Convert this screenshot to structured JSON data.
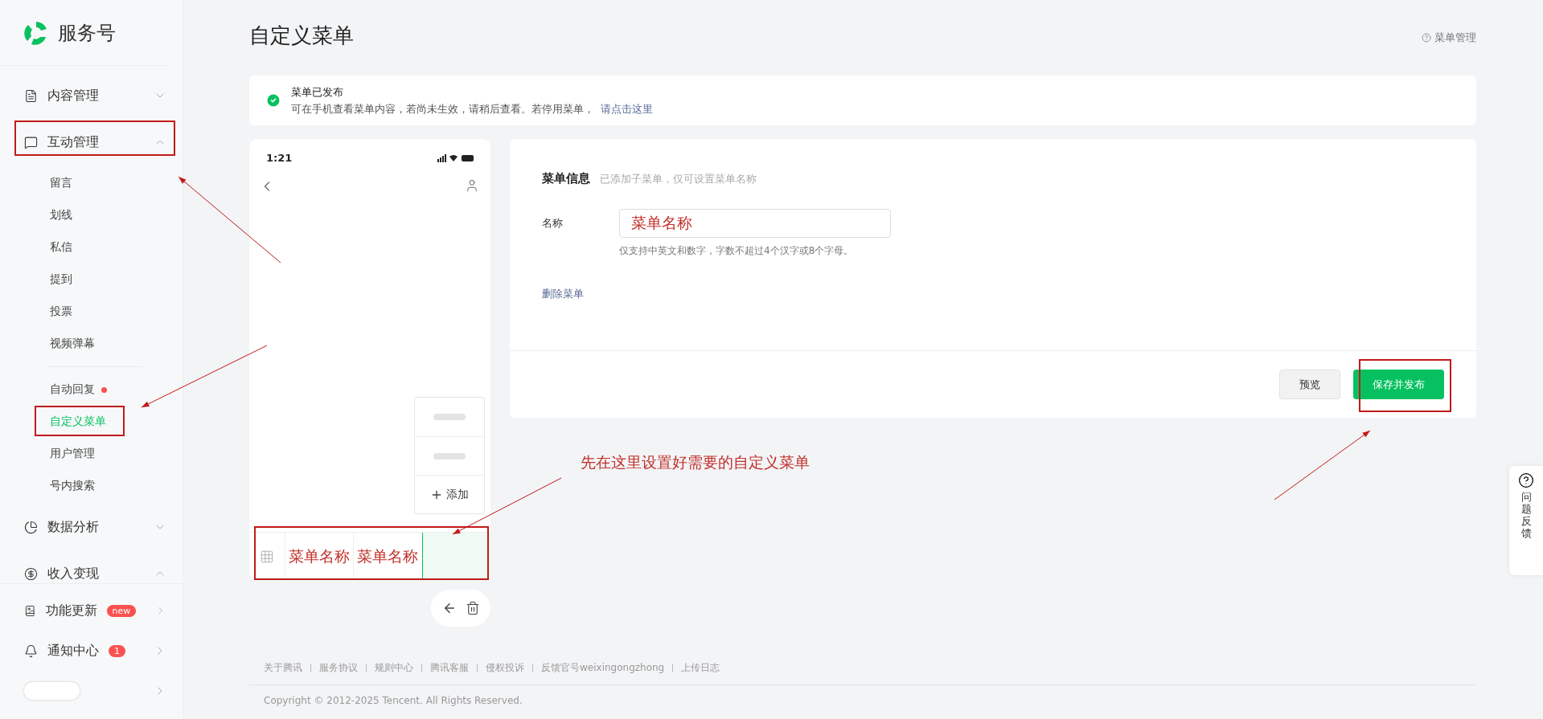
{
  "brand": {
    "name": "服务号"
  },
  "sidebar": {
    "groups": [
      {
        "label": "内容管理",
        "expanded": false,
        "selected": false
      },
      {
        "label": "互动管理",
        "expanded": true,
        "selected": false,
        "sections": [
          {
            "items": [
              {
                "label": "留言",
                "selected": false,
                "dot": false
              },
              {
                "label": "划线",
                "selected": false,
                "dot": false
              },
              {
                "label": "私信",
                "selected": false,
                "dot": false
              },
              {
                "label": "提到",
                "selected": false,
                "dot": false
              },
              {
                "label": "投票",
                "selected": false,
                "dot": false
              },
              {
                "label": "视频弹幕",
                "selected": false,
                "dot": false
              }
            ]
          },
          {
            "items": [
              {
                "label": "自动回复",
                "selected": false,
                "dot": true
              },
              {
                "label": "自定义菜单",
                "selected": true,
                "dot": false
              },
              {
                "label": "用户管理",
                "selected": false,
                "dot": false
              },
              {
                "label": "号内搜索",
                "selected": false,
                "dot": false
              }
            ]
          }
        ]
      },
      {
        "label": "数据分析",
        "expanded": false,
        "selected": false
      },
      {
        "label": "收入变现",
        "expanded": true,
        "selected": false
      }
    ],
    "bottom": [
      {
        "kind": "link",
        "label": "功能更新",
        "badge": "new"
      },
      {
        "kind": "link",
        "label": "通知中心",
        "badge": "1"
      },
      {
        "kind": "account"
      }
    ]
  },
  "page": {
    "title": "自定义菜单",
    "help_link": "菜单管理"
  },
  "notice": {
    "title": "菜单已发布",
    "text": "可在手机查看菜单内容，若尚未生效，请稍后查看。若停用菜单，",
    "link": "请点击这里"
  },
  "phone": {
    "time": "1:21",
    "submenu": [
      {
        "kind": "blank"
      },
      {
        "kind": "blank"
      },
      {
        "kind": "add",
        "label": "添加"
      }
    ],
    "menu": [
      {
        "label": "菜单名称",
        "selected": false
      },
      {
        "label": "菜单名称",
        "selected": false
      },
      {
        "selected": true
      }
    ]
  },
  "menu_info": {
    "title": "菜单信息",
    "subtitle": "已添加子菜单，仅可设置菜单名称",
    "name_label": "名称",
    "name_value": "菜单名称",
    "hint": "仅支持中英文和数字，字数不超过4个汉字或8个字母。",
    "delete_link": "删除菜单",
    "buttons": [
      {
        "label": "预览",
        "kind": "secondary"
      },
      {
        "label": "保存并发布",
        "kind": "primary"
      }
    ]
  },
  "feedback": {
    "label": "问题反馈"
  },
  "footer": {
    "links": [
      "关于腾讯",
      "服务协议",
      "规则中心",
      "腾讯客服",
      "侵权投诉",
      "反馈官号weixingongzhong",
      "上传日志"
    ],
    "copyright": "Copyright © 2012-2025 Tencent. All Rights Reserved."
  },
  "annotation": {
    "note": "先在这里设置好需要的自定义菜单"
  }
}
